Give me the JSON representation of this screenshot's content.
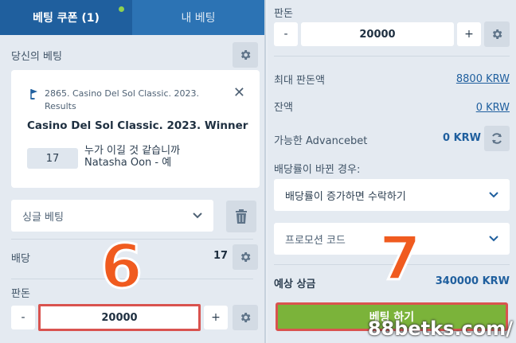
{
  "tabs": {
    "coupon": "베팅 쿠폰 (1)",
    "my_bets": "내 베팅"
  },
  "left": {
    "your_bets_label": "당신의 베팅",
    "card": {
      "event": "2865. Casino Del Sol Classic. 2023. Results",
      "close": "✕",
      "title": "Casino Del Sol Classic. 2023. Winner",
      "odds": "17",
      "question": "누가 이길 것 같습니까",
      "selection": "Natasha Oon - 예"
    },
    "bet_type": "싱글 베팅",
    "odds_label": "배당",
    "odds_value": "17",
    "stake_label": "판돈",
    "stake": {
      "minus": "-",
      "value": "20000",
      "plus": "+"
    },
    "annotation": "6"
  },
  "right": {
    "stake_label": "판돈",
    "stake": {
      "minus": "-",
      "value": "20000",
      "plus": "+"
    },
    "max_stake_label": "최대 판돈액",
    "max_stake_value": "8800 KRW",
    "balance_label": "잔액",
    "balance_value": "0 KRW",
    "advancebet_label": "가능한 Advancebet",
    "advancebet_value": "0 KRW",
    "odds_change_label": "배당률이 바뀐 경우:",
    "odds_change_option": "배당률이 증가하면 수락하기",
    "promo_placeholder": "프로모션 코드",
    "potential_win_label": "예상 상금",
    "potential_win_value": "340000 KRW",
    "place_bet": "베팅 하기",
    "annotation": "7"
  },
  "watermark": "88betks.com/",
  "colors": {
    "primary": "#1f5f9e",
    "accent_green": "#7bb33a",
    "annotation_orange": "#f05b1f",
    "highlight_red": "#d9534f"
  }
}
